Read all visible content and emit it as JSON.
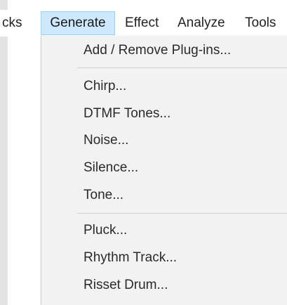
{
  "menubar": {
    "items": [
      {
        "label": "cks",
        "active": false
      },
      {
        "label": "Generate",
        "active": true
      },
      {
        "label": "Effect",
        "active": false
      },
      {
        "label": "Analyze",
        "active": false
      },
      {
        "label": "Tools",
        "active": false
      }
    ]
  },
  "generate_menu": {
    "add_remove": "Add / Remove Plug-ins...",
    "group1": [
      "Chirp...",
      "DTMF Tones...",
      "Noise...",
      "Silence...",
      "Tone..."
    ],
    "group2": [
      "Pluck...",
      "Rhythm Track...",
      "Risset Drum..."
    ]
  },
  "colors": {
    "menubar_active_bg": "#cde8ff",
    "menubar_active_border": "#99d1ff",
    "menu_bg": "#f2f2f2",
    "separator": "#cfcfcf",
    "text": "#2a2a2a"
  }
}
